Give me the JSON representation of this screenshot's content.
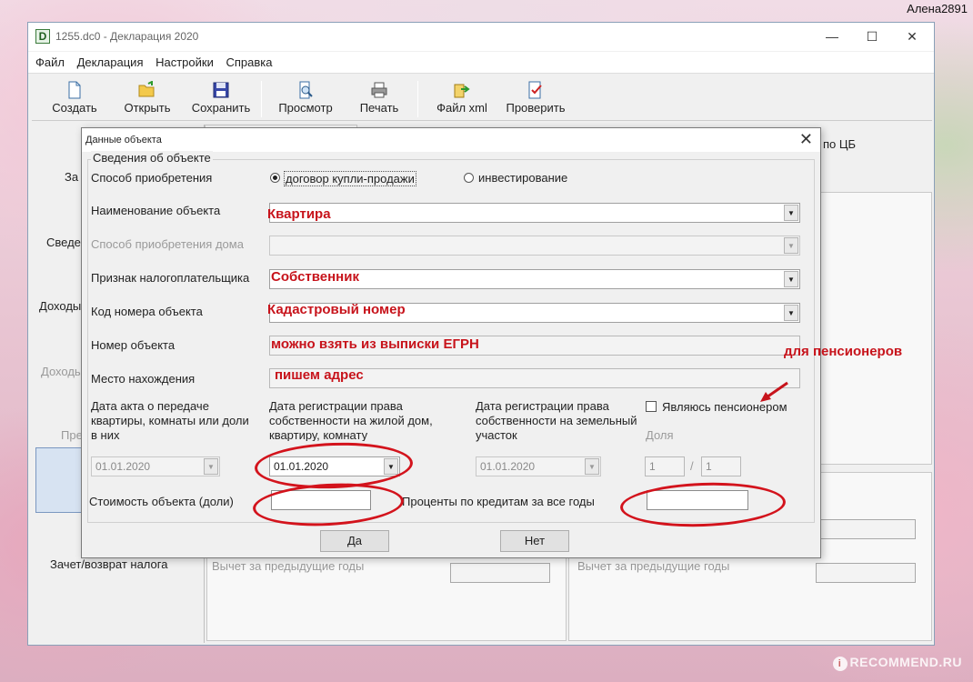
{
  "watermark": {
    "user": "Алена2891",
    "site": "RECOMMEND.RU"
  },
  "window": {
    "icon_letter": "D",
    "title": "1255.dc0 - Декларация 2020",
    "controls": {
      "minimize": "—",
      "maximize": "☐",
      "close": "✕"
    }
  },
  "menu": [
    "Файл",
    "Декларация",
    "Настройки",
    "Справка"
  ],
  "toolbar": {
    "create": "Создать",
    "open": "Открыть",
    "save": "Сохранить",
    "preview": "Просмотр",
    "print": "Печать",
    "xml": "Файл xml",
    "check": "Проверить"
  },
  "left_pane": {
    "items": [
      "За",
      "Сведе",
      "Доходы",
      "Доходь",
      "Пре"
    ],
    "bottom": "Зачет/возврат налога"
  },
  "background": {
    "top_right_label": "по ЦБ",
    "prev_years_left": "Вычет за предыдущие годы",
    "prev_years_right": "Вычет за предыдущие годы"
  },
  "dialog": {
    "title": "Данные объекта",
    "close": "✕",
    "group_title": "Сведения об объекте",
    "acquisition": {
      "label": "Способ приобретения",
      "option1": "договор купли-продажи",
      "option2": "инвестирование",
      "selected": "option1"
    },
    "object_name": {
      "label": "Наименование объекта",
      "annotation": "Квартира"
    },
    "house_acquisition": {
      "label": "Способ приобретения дома"
    },
    "taxpayer_sign": {
      "label": "Признак налогоплательщика",
      "annotation": "Собственник"
    },
    "object_code": {
      "label": "Код номера объекта",
      "annotation": "Кадастровый номер"
    },
    "object_number": {
      "label": "Номер объекта",
      "annotation": "можно взять из выписки ЕГРН"
    },
    "location": {
      "label": "Место нахождения",
      "annotation": "пишем адрес"
    },
    "pensioner_note": "для пенсионеров",
    "pensioner_checkbox": "Являюсь пенсионером",
    "act_date": {
      "label": "Дата акта о передаче квартиры, комнаты или доли в них",
      "value": "01.01.2020"
    },
    "reg_date_house": {
      "label": "Дата регистрации права собственности на жилой дом, квартиру, комнату",
      "value": "01.01.2020"
    },
    "reg_date_land": {
      "label": "Дата регистрации права собственности на земельный участок",
      "value": "01.01.2020"
    },
    "share": {
      "label": "Доля",
      "numerator": "1",
      "separator": "/",
      "denominator": "1"
    },
    "cost": {
      "label": "Стоимость объекта (доли)",
      "value": ""
    },
    "credit_interest": {
      "label": "Проценты по кредитам за все годы",
      "value": ""
    },
    "ok": "Да",
    "cancel": "Нет"
  },
  "colors": {
    "annotation": "#c7131b",
    "dialog_bg": "#f0f0f0"
  }
}
